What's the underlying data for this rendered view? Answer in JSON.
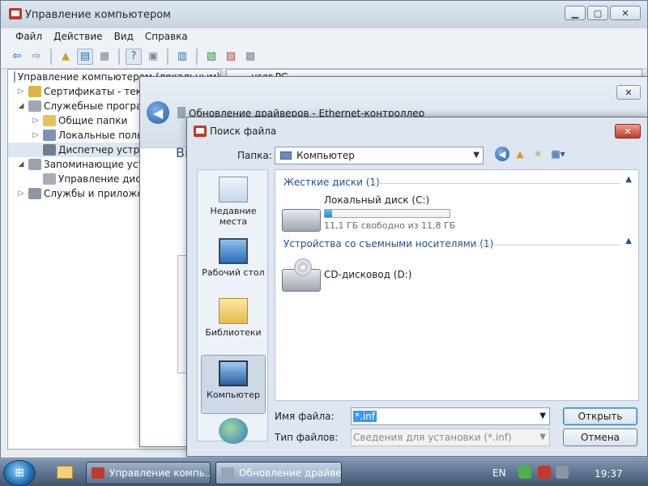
{
  "main_window": {
    "title": "Управление компьютером",
    "menu": [
      "Файл",
      "Действие",
      "Вид",
      "Справка"
    ],
    "tree": [
      {
        "label": "Управление компьютером (локальным)",
        "indent": 0,
        "expand": ""
      },
      {
        "label": "Сертификаты - текущ",
        "indent": 1,
        "expand": "▷"
      },
      {
        "label": "Служебные програм",
        "indent": 1,
        "expand": "◢"
      },
      {
        "label": "Общие папки",
        "indent": 2,
        "expand": "▷"
      },
      {
        "label": "Локальные польз",
        "indent": 2,
        "expand": "▷"
      },
      {
        "label": "Диспетчер устрой",
        "indent": 2,
        "expand": ""
      },
      {
        "label": "Запоминающие устр",
        "indent": 1,
        "expand": "◢"
      },
      {
        "label": "Управление диска",
        "indent": 2,
        "expand": ""
      },
      {
        "label": "Службы и приложен",
        "indent": 1,
        "expand": "▷"
      }
    ],
    "right_pane_text": "user-PC",
    "controls": {
      "minimize": "▁",
      "maximize": "▢",
      "close": "✕"
    }
  },
  "driver_window": {
    "title": "Обновление драйверов - Ethernet-контроллер",
    "partial_text": "Вы",
    "close": "✕",
    "back": "◀"
  },
  "file_dialog": {
    "title": "Поиск файла",
    "close": "✕",
    "folder_label": "Папка:",
    "folder_value": "Компьютер",
    "places": [
      {
        "label": "Недавние места",
        "icon": "recent-places-icon"
      },
      {
        "label": "Рабочий стол",
        "icon": "desktop-icon"
      },
      {
        "label": "Библиотеки",
        "icon": "libraries-icon"
      },
      {
        "label": "Компьютер",
        "icon": "computer-icon"
      },
      {
        "label": "",
        "icon": "network-icon"
      }
    ],
    "groups": {
      "hard_disks": "Жесткие диски (1)",
      "removable": "Устройства со съемными носителями (1)"
    },
    "drives": {
      "c": {
        "name": "Локальный диск (C:)",
        "free_text": "11,1 ГБ свободно из 11,8 ГБ",
        "used_percent": 6
      },
      "d": {
        "name": "CD-дисковод (D:)"
      }
    },
    "filename_label": "Имя файла:",
    "filename_value": "*.inf",
    "filetype_label": "Тип файлов:",
    "filetype_value": "Сведения для установки (*.inf)",
    "open_button": "Открыть",
    "cancel_button": "Отмена"
  },
  "taskbar": {
    "start": "⊞",
    "tasks": [
      {
        "label": "Управление компь..."
      },
      {
        "label": "Обновление драйве..."
      }
    ],
    "lang": "EN",
    "time": "19:37"
  },
  "colors": {
    "accent": "#1e5ea8",
    "close_red": "#c0392b",
    "progress": "#1a8cd0"
  }
}
